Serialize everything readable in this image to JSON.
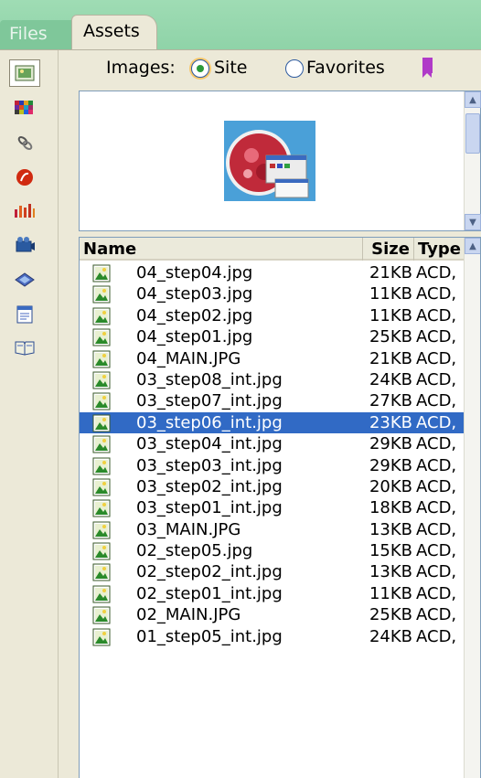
{
  "tabs": {
    "files_label": "Files",
    "assets_label": "Assets"
  },
  "toolbar": {
    "icons": [
      "images-icon",
      "colors-icon",
      "urls-icon",
      "flash-icon",
      "shockwave-icon",
      "movies-icon",
      "scripts-icon",
      "templates-icon",
      "library-icon"
    ]
  },
  "images_filter": {
    "label": "Images:",
    "site_label": "Site",
    "favorites_label": "Favorites",
    "selected": "Site"
  },
  "list": {
    "headers": {
      "name": "Name",
      "size": "Size",
      "type": "Type"
    },
    "rows": [
      {
        "name": "04_step04.jpg",
        "size": "21KB",
        "type": "ACD,"
      },
      {
        "name": "04_step03.jpg",
        "size": "11KB",
        "type": "ACD,"
      },
      {
        "name": "04_step02.jpg",
        "size": "11KB",
        "type": "ACD,"
      },
      {
        "name": "04_step01.jpg",
        "size": "25KB",
        "type": "ACD,"
      },
      {
        "name": "04_MAIN.JPG",
        "size": "21KB",
        "type": "ACD,"
      },
      {
        "name": "03_step08_int.jpg",
        "size": "24KB",
        "type": "ACD,"
      },
      {
        "name": "03_step07_int.jpg",
        "size": "27KB",
        "type": "ACD,"
      },
      {
        "name": "03_step06_int.jpg",
        "size": "23KB",
        "type": "ACD,"
      },
      {
        "name": "03_step04_int.jpg",
        "size": "29KB",
        "type": "ACD,"
      },
      {
        "name": "03_step03_int.jpg",
        "size": "29KB",
        "type": "ACD,"
      },
      {
        "name": "03_step02_int.jpg",
        "size": "20KB",
        "type": "ACD,"
      },
      {
        "name": "03_step01_int.jpg",
        "size": "18KB",
        "type": "ACD,"
      },
      {
        "name": "03_MAIN.JPG",
        "size": "13KB",
        "type": "ACD,"
      },
      {
        "name": "02_step05.jpg",
        "size": "15KB",
        "type": "ACD,"
      },
      {
        "name": "02_step02_int.jpg",
        "size": "13KB",
        "type": "ACD,"
      },
      {
        "name": "02_step01_int.jpg",
        "size": "11KB",
        "type": "ACD,"
      },
      {
        "name": "02_MAIN.JPG",
        "size": "25KB",
        "type": "ACD,"
      },
      {
        "name": "01_step05_int.jpg",
        "size": "24KB",
        "type": "ACD,"
      }
    ],
    "selected_index": 7
  },
  "colors": {
    "selection": "#316ac5",
    "panel_bg": "#ece9d8",
    "desktop_bg": "#8fd3a8"
  }
}
